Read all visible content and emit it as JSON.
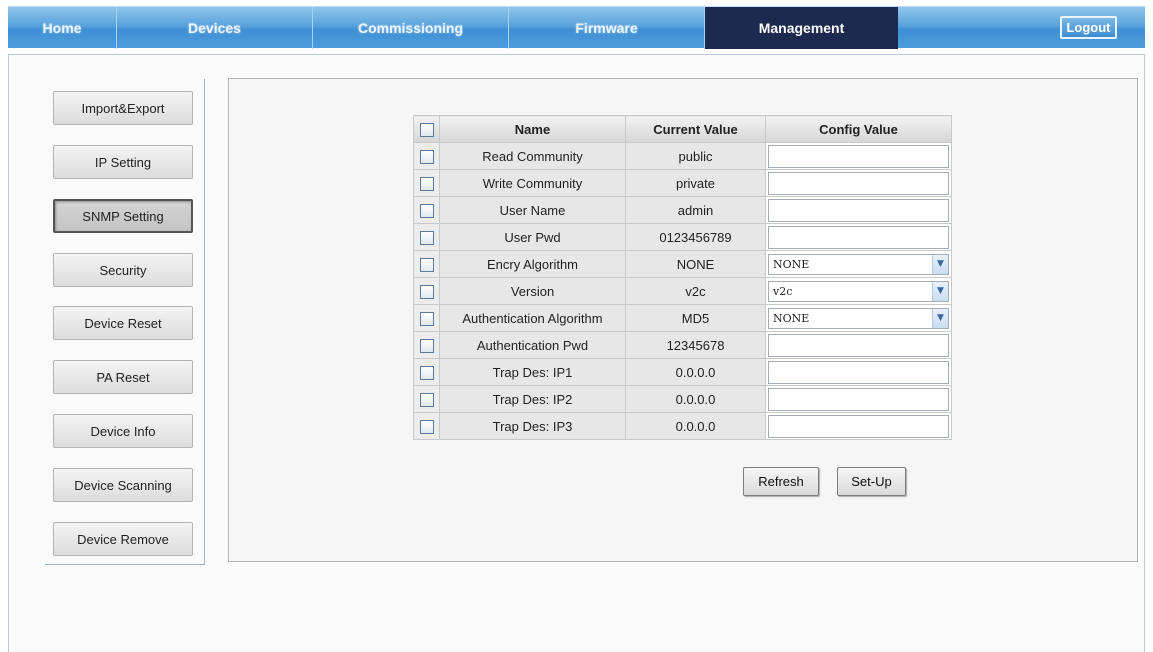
{
  "nav": {
    "tabs": [
      {
        "label": "Home"
      },
      {
        "label": "Devices"
      },
      {
        "label": "Commissioning"
      },
      {
        "label": "Firmware"
      },
      {
        "label": "Management"
      }
    ],
    "logout_label": "Logout",
    "active_tab": "Management"
  },
  "sidebar": {
    "items": [
      {
        "label": "Import&Export"
      },
      {
        "label": "IP Setting"
      },
      {
        "label": "SNMP Setting"
      },
      {
        "label": "Security"
      },
      {
        "label": "Device Reset"
      },
      {
        "label": "PA Reset"
      },
      {
        "label": "Device Info"
      },
      {
        "label": "Device Scanning"
      },
      {
        "label": "Device Remove"
      }
    ],
    "active_item": "SNMP Setting"
  },
  "table": {
    "headers": {
      "name": "Name",
      "current": "Current Value",
      "config": "Config Value"
    },
    "rows": [
      {
        "name": "Read Community",
        "current": "public",
        "config": ""
      },
      {
        "name": "Write Community",
        "current": "private",
        "config": ""
      },
      {
        "name": "User Name",
        "current": "admin",
        "config": ""
      },
      {
        "name": "User Pwd",
        "current": "0123456789",
        "config": ""
      },
      {
        "name": "Encry Algorithm",
        "current": "NONE",
        "config": "NONE"
      },
      {
        "name": "Version",
        "current": "v2c",
        "config": "v2c"
      },
      {
        "name": "Authentication Algorithm",
        "current": "MD5",
        "config": "NONE"
      },
      {
        "name": "Authentication Pwd",
        "current": "12345678",
        "config": ""
      },
      {
        "name": "Trap Des: IP1",
        "current": "0.0.0.0",
        "config": ""
      },
      {
        "name": "Trap Des: IP2",
        "current": "0.0.0.0",
        "config": ""
      },
      {
        "name": "Trap Des: IP3",
        "current": "0.0.0.0",
        "config": ""
      }
    ]
  },
  "actions": {
    "refresh_label": "Refresh",
    "setup_label": "Set-Up"
  },
  "colors": {
    "nav_active": "#1b2a4e",
    "nav_bar": "#4f9ddd"
  }
}
